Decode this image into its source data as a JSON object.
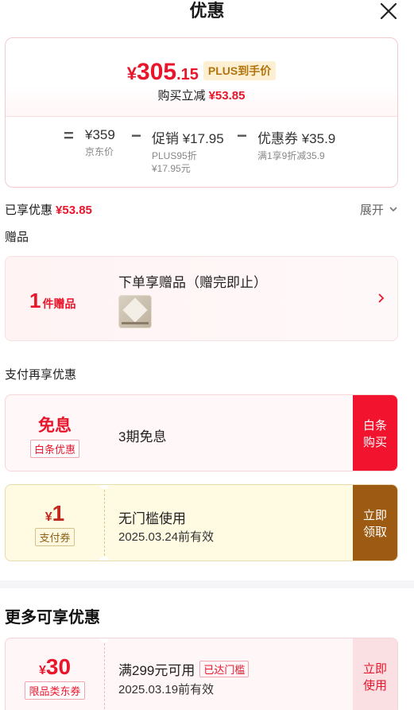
{
  "header": {
    "title": "优惠",
    "close_icon": "close-icon"
  },
  "price": {
    "yen": "¥",
    "integer": "305",
    "decimal": ".15",
    "plus_tag": "PLUS到手价",
    "reduce_label": "购买立减",
    "reduce_value": "¥53.85"
  },
  "breakdown": {
    "eq": "=",
    "minus1": "−",
    "minus2": "−",
    "jd_price": {
      "main": "¥359",
      "sub": "京东价"
    },
    "promo": {
      "main": "促销 ¥17.95",
      "sub1": "PLUS95折",
      "sub2": "¥17.95元"
    },
    "coupon": {
      "main": "优惠券 ¥35.9",
      "sub": "满1享9折减35.9"
    }
  },
  "enjoyed": {
    "label": "已享优惠",
    "value": "¥53.85",
    "expand": "展开"
  },
  "gift": {
    "section_title": "赠品",
    "count": "1",
    "count_label": "件赠品",
    "title": "下单享赠品（赠完即止）"
  },
  "pay": {
    "section_title": "支付再享优惠",
    "baitiao": {
      "big": "免息",
      "tag": "白条优惠",
      "desc": "3期免息",
      "button": "白条购买"
    },
    "pay_coupon": {
      "yen": "¥",
      "amount": "1",
      "tag": "支付券",
      "desc": "无门槛使用",
      "expire": "2025.03.24前有效",
      "button": "立即领取"
    }
  },
  "more": {
    "title": "更多可享优惠",
    "jd_coupon": {
      "yen": "¥",
      "amount": "30",
      "tag": "限品类东券",
      "desc": "满299元可用",
      "reached": "已达门槛",
      "expire": "2025.03.19前有效",
      "button": "立即使用"
    }
  },
  "colors": {
    "accent": "#e8152b",
    "plus_gold": "#b3740c",
    "pay_brown": "#9d5a12"
  }
}
